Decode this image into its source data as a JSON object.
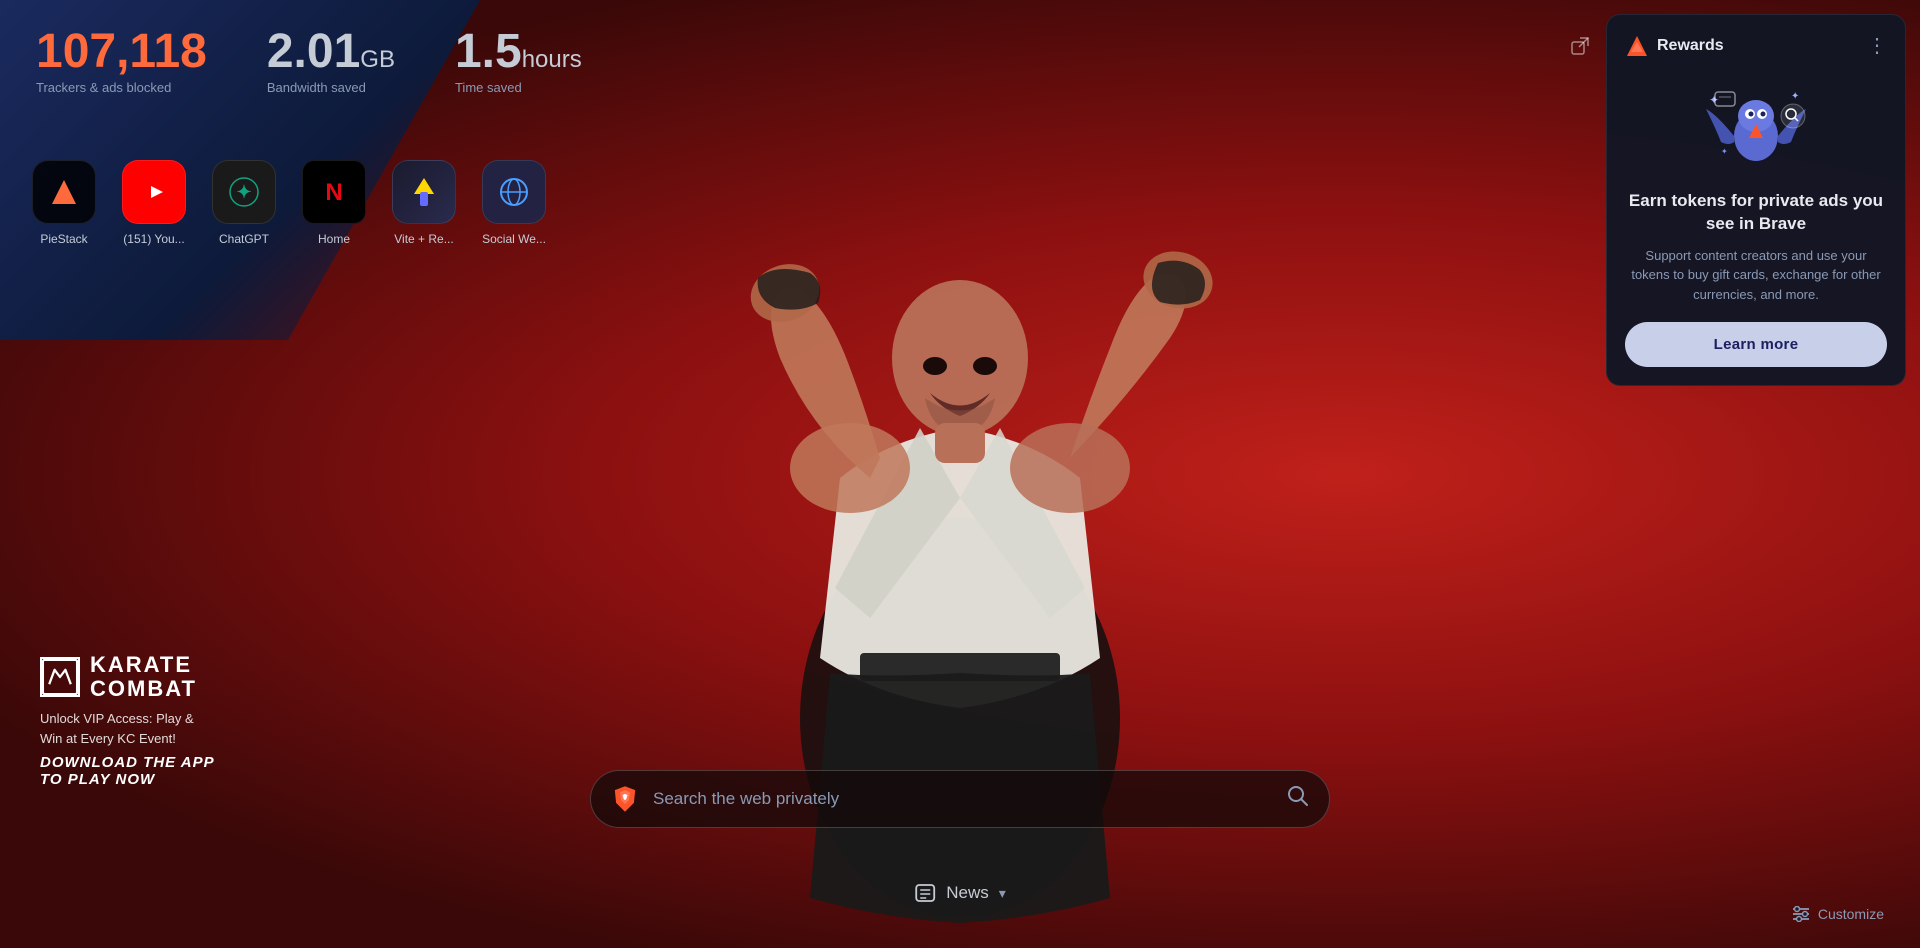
{
  "stats": {
    "trackers": {
      "number": "107,118",
      "label": "Trackers & ads blocked"
    },
    "bandwidth": {
      "number": "2.01",
      "unit": "GB",
      "label": "Bandwidth saved"
    },
    "time": {
      "number": "1.5",
      "unit": "hours",
      "label": "Time saved"
    }
  },
  "shortcuts": [
    {
      "id": "piestack",
      "label": "PieStack",
      "icon": "▲",
      "bg": "#000",
      "color": "#ff6a3d"
    },
    {
      "id": "youtube",
      "label": "(151) You...",
      "icon": "▶",
      "bg": "#ff0000",
      "color": "#fff"
    },
    {
      "id": "chatgpt",
      "label": "ChatGPT",
      "icon": "✦",
      "bg": "#1a1a1a",
      "color": "#10a37f"
    },
    {
      "id": "home",
      "label": "Home",
      "icon": "N",
      "bg": "#000",
      "color": "#e50914"
    },
    {
      "id": "vite",
      "label": "Vite + Re...",
      "icon": "⚡",
      "bg": "#1a1a2e",
      "color": "#ffd700"
    },
    {
      "id": "social",
      "label": "Social We...",
      "icon": "🌐",
      "bg": "#1a2a4a",
      "color": "#4a9eff"
    }
  ],
  "search": {
    "placeholder": "Search the web privately"
  },
  "news": {
    "label": "News"
  },
  "customize": {
    "label": "Customize"
  },
  "rewards": {
    "title": "Rewards",
    "menu_label": "⋮",
    "main_text": "Earn tokens for private ads you see in Brave",
    "sub_text": "Support content creators and use your tokens to buy gift cards, exchange for other currencies, and more.",
    "learn_more": "Learn more"
  },
  "karate_combat": {
    "name_line1": "KARATE",
    "name_line2": "COMBAT",
    "sub": "Unlock VIP Access: Play &\nWin at Every KC Event!",
    "cta": "DOWNLOAD THE APP\nTO PLAY NOW"
  }
}
